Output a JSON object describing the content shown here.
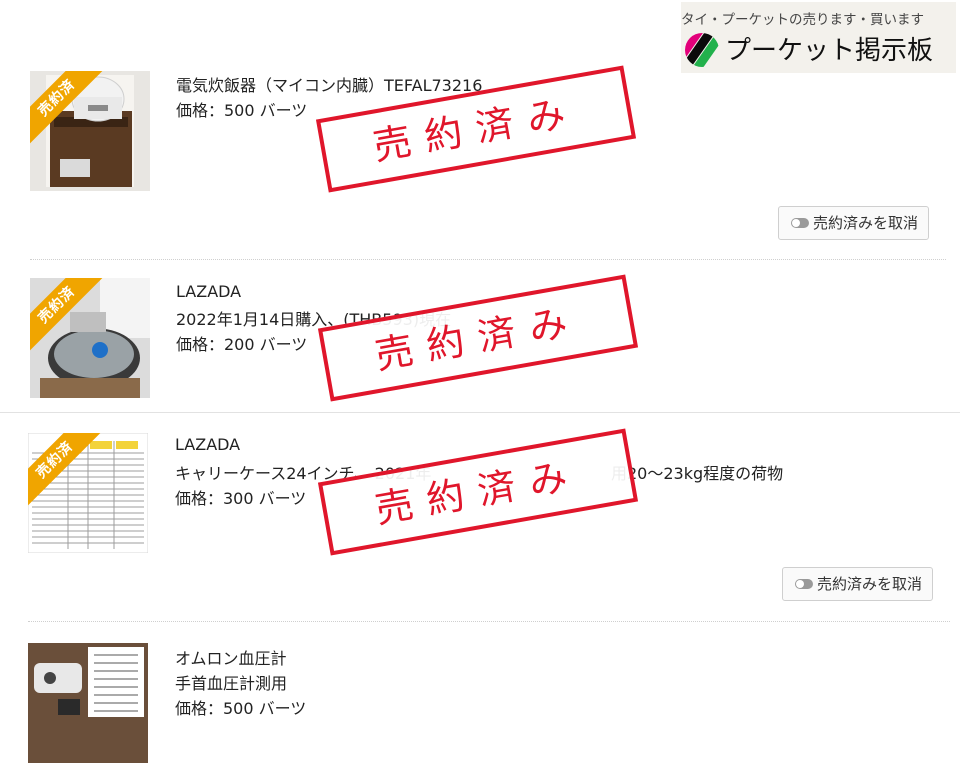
{
  "header": {
    "tagline": "タイ・プーケットの売ります・買います",
    "site_title": "プーケット掲示板",
    "logo_colors": [
      "#1d6fd8",
      "#ffd400",
      "#e2007a",
      "#0a0a0a",
      "#22b14c"
    ]
  },
  "colors": {
    "stamp_red": "#e0162b",
    "ribbon_orange": "#f0a500"
  },
  "listings": [
    {
      "ribbon": "売約済",
      "title": "電気炊飯器（マイコン内臓）TEFAL73216",
      "desc": "",
      "price": "価格：500 バーツ",
      "stamp": "売約済み",
      "cancel_label": "売約済みを取消"
    },
    {
      "ribbon": "売約済",
      "title": "LAZADA",
      "desc": "2022年1月14日購入、(THB593)現在",
      "price": "価格：200 バーツ",
      "stamp": "売約済み",
      "cancel_label": ""
    },
    {
      "ribbon": "売約済",
      "title": "LAZADA",
      "desc": "キャリーケース24インチ、 2021年",
      "desc2": "用20～23kg程度の荷物",
      "price": "価格：300 バーツ",
      "stamp": "売約済み",
      "cancel_label": "売約済みを取消"
    },
    {
      "ribbon": "",
      "title": "オムロン血圧計",
      "desc": "手首血圧計測用",
      "price": "価格：500 バーツ",
      "stamp": "",
      "cancel_label": ""
    }
  ]
}
